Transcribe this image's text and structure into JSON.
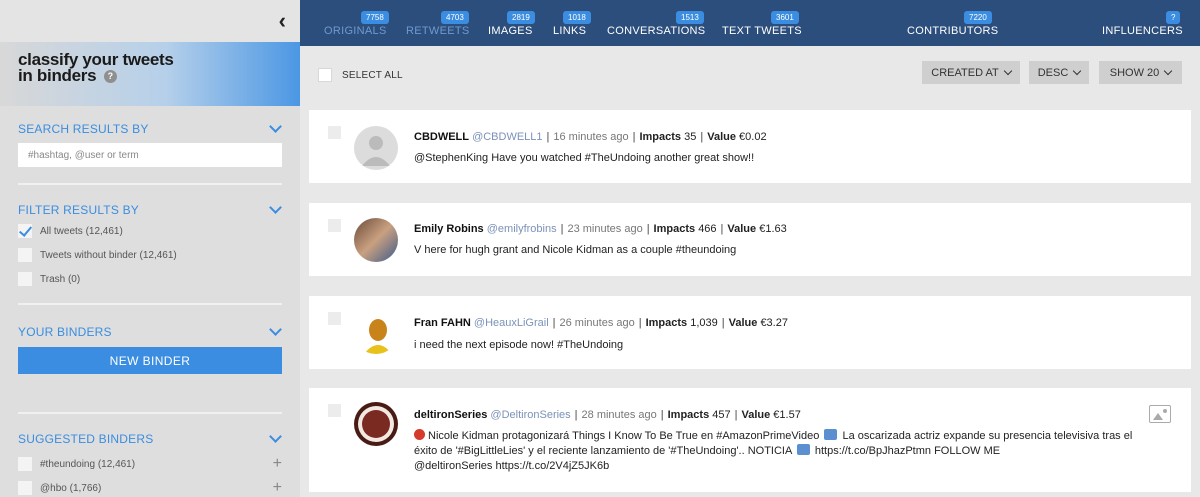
{
  "sidebar": {
    "hero_title_line1": "classify your tweets",
    "hero_title_line2": "in binders",
    "help": "?",
    "search_section": "SEARCH RESULTS BY",
    "search_placeholder": "#hashtag, @user or term",
    "filter_section": "FILTER RESULTS BY",
    "filters": [
      {
        "label": "All tweets (12,461)",
        "checked": true
      },
      {
        "label": "Tweets without binder (12,461)",
        "checked": false
      },
      {
        "label": "Trash (0)",
        "checked": false
      }
    ],
    "binders_section": "YOUR BINDERS",
    "new_binder": "NEW BINDER",
    "suggested_section": "SUGGESTED BINDERS",
    "suggested": [
      {
        "label": "#theundoing (12,461)"
      },
      {
        "label": "@hbo (1,766)"
      }
    ]
  },
  "nav": [
    {
      "label": "ORIGINALS",
      "count": "7758"
    },
    {
      "label": "RETWEETS",
      "count": "4703"
    },
    {
      "label": "IMAGES",
      "count": "2819"
    },
    {
      "label": "LINKS",
      "count": "1018"
    },
    {
      "label": "CONVERSATIONS",
      "count": "1513"
    },
    {
      "label": "TEXT TWEETS",
      "count": "3601"
    },
    {
      "label": "CONTRIBUTORS",
      "count": "7220"
    },
    {
      "label": "INFLUENCERS",
      "count": "?"
    }
  ],
  "toolbar": {
    "select_all": "SELECT ALL",
    "sort_by": "CREATED AT",
    "order": "DESC",
    "show": "SHOW 20"
  },
  "tweets": [
    {
      "name": "CBDWELL",
      "handle": "@CBDWELL1",
      "time": "16 minutes ago",
      "impacts_label": "Impacts",
      "impacts": "35",
      "value_label": "Value",
      "value": "€0.02",
      "text": "@StephenKing Have you watched #TheUndoing another great show!!"
    },
    {
      "name": "Emily Robins",
      "handle": "@emilyfrobins",
      "time": "23 minutes ago",
      "impacts_label": "Impacts",
      "impacts": "466",
      "value_label": "Value",
      "value": "€1.63",
      "text": "V here for hugh grant and Nicole Kidman as a couple #theundoing"
    },
    {
      "name": "Fran FAHN",
      "handle": "@HeauxLiGrail",
      "time": "26 minutes ago",
      "impacts_label": "Impacts",
      "impacts": "1,039",
      "value_label": "Value",
      "value": "€3.27",
      "text": "i need the next episode now! #TheUndoing"
    },
    {
      "name": "deltironSeries",
      "handle": "@DeltironSeries",
      "time": "28 minutes ago",
      "impacts_label": "Impacts",
      "impacts": "457",
      "value_label": "Value",
      "value": "€1.57",
      "text_1": "Nicole Kidman protagonizará Things I Know To Be True en #AmazonPrimeVideo",
      "text_2": "La oscarizada actriz expande su presencia televisiva",
      "text_3": "tras el éxito de '#BigLittleLies' y el reciente lanzamiento de '#TheUndoing'.. NOTICIA",
      "text_4": "https://t.co/BpJhazPtmn FOLLOW ME",
      "text_5": "@deltironSeries https://t.co/2V4jZ5JK6b"
    }
  ],
  "colors": {
    "accent": "#3a8de0",
    "nav_bg": "#2c4e7c",
    "sidebar_bg": "#dedede"
  }
}
